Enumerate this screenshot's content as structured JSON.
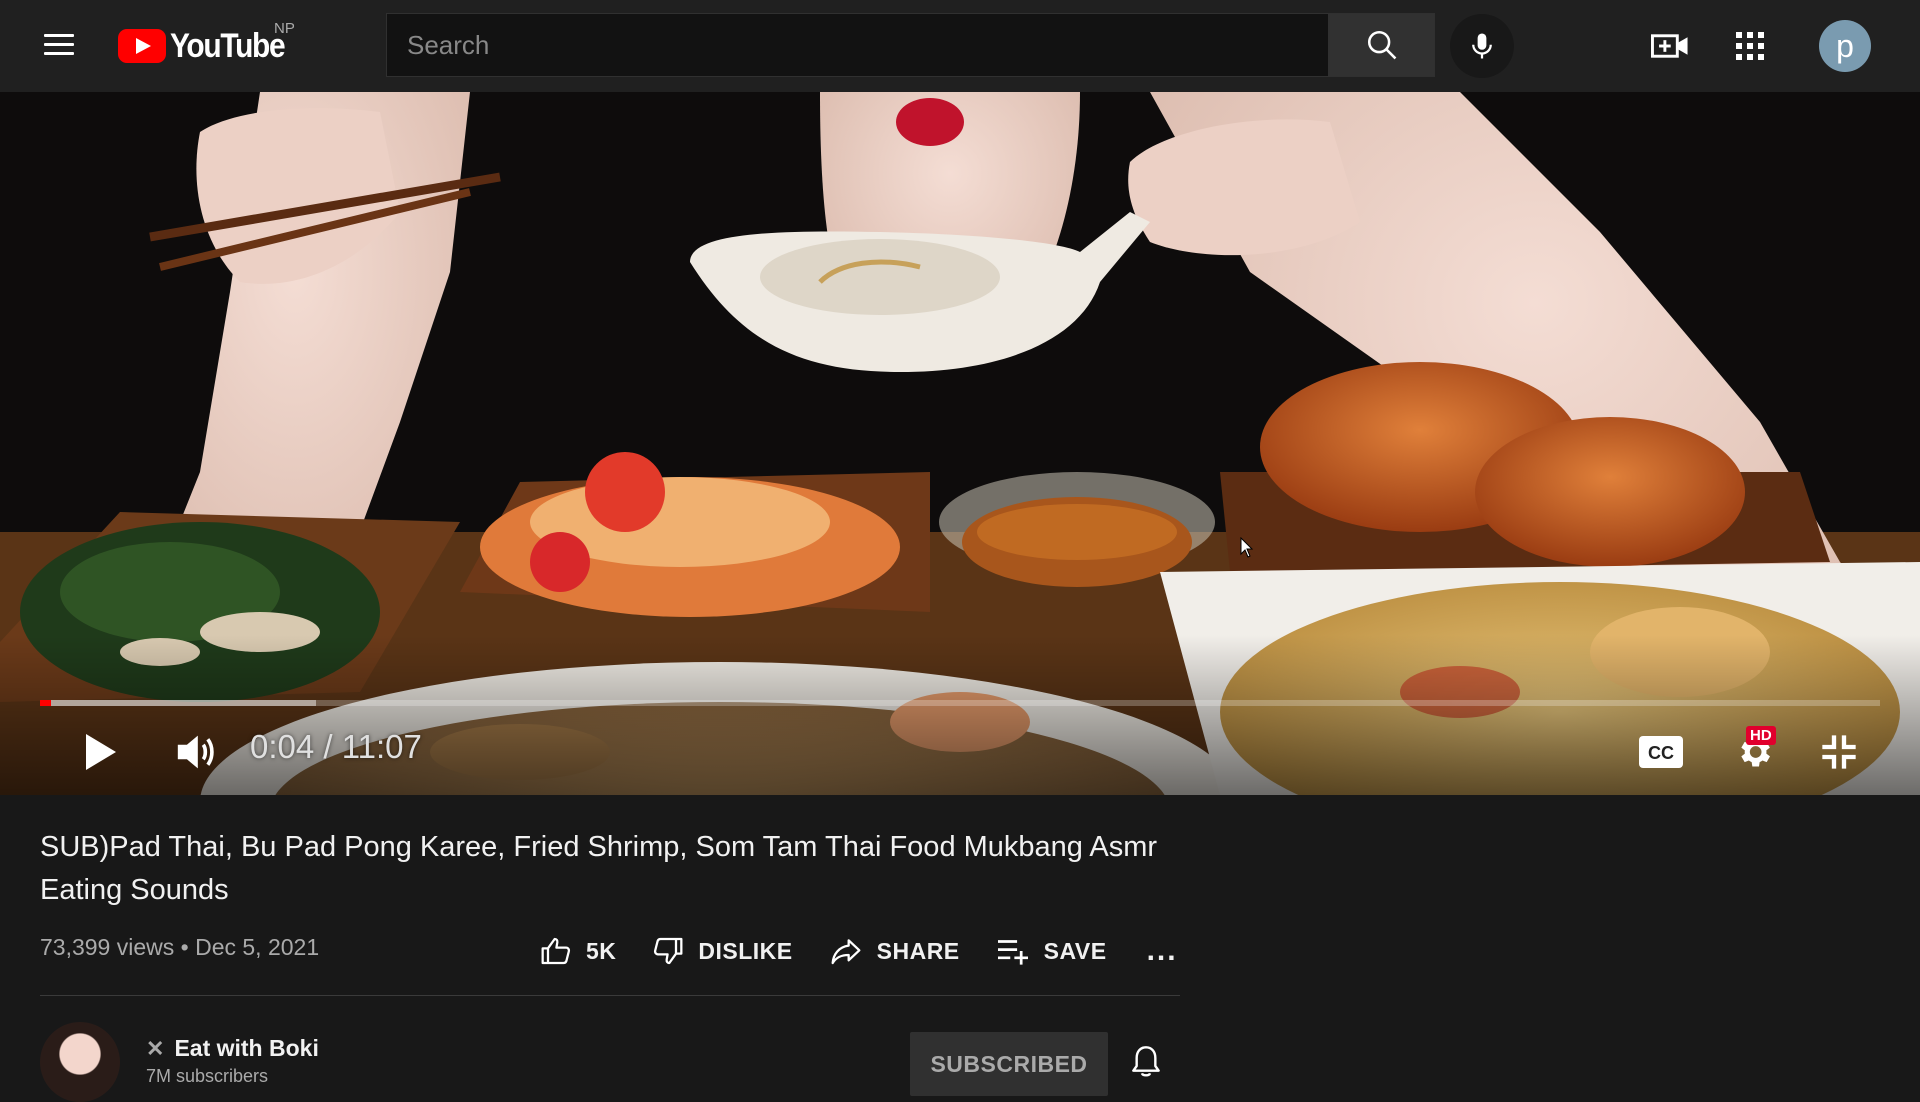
{
  "header": {
    "logo_text": "YouTube",
    "country_code": "NP",
    "search_placeholder": "Search",
    "avatar_letter": "p"
  },
  "player": {
    "current_time": "0:04",
    "duration": "11:07",
    "time_display": "0:04 / 11:07",
    "progress_fraction": 0.006,
    "buffered_fraction": 0.15,
    "quality_badge": "HD",
    "accent_color": "#ff0000"
  },
  "video": {
    "title": "SUB)Pad Thai, Bu Pad Pong Karee, Fried Shrimp, Som Tam Thai Food Mukbang Asmr Eating Sounds",
    "views": "73,399 views",
    "date": "Dec 5, 2021",
    "meta_separator": "•",
    "like_count": "5K",
    "dislike_label": "DISLIKE",
    "share_label": "SHARE",
    "save_label": "SAVE",
    "more_label": "..."
  },
  "channel": {
    "name": "Eat with Boki",
    "subscribers": "7M subscribers",
    "subscribe_state": "SUBSCRIBED"
  }
}
